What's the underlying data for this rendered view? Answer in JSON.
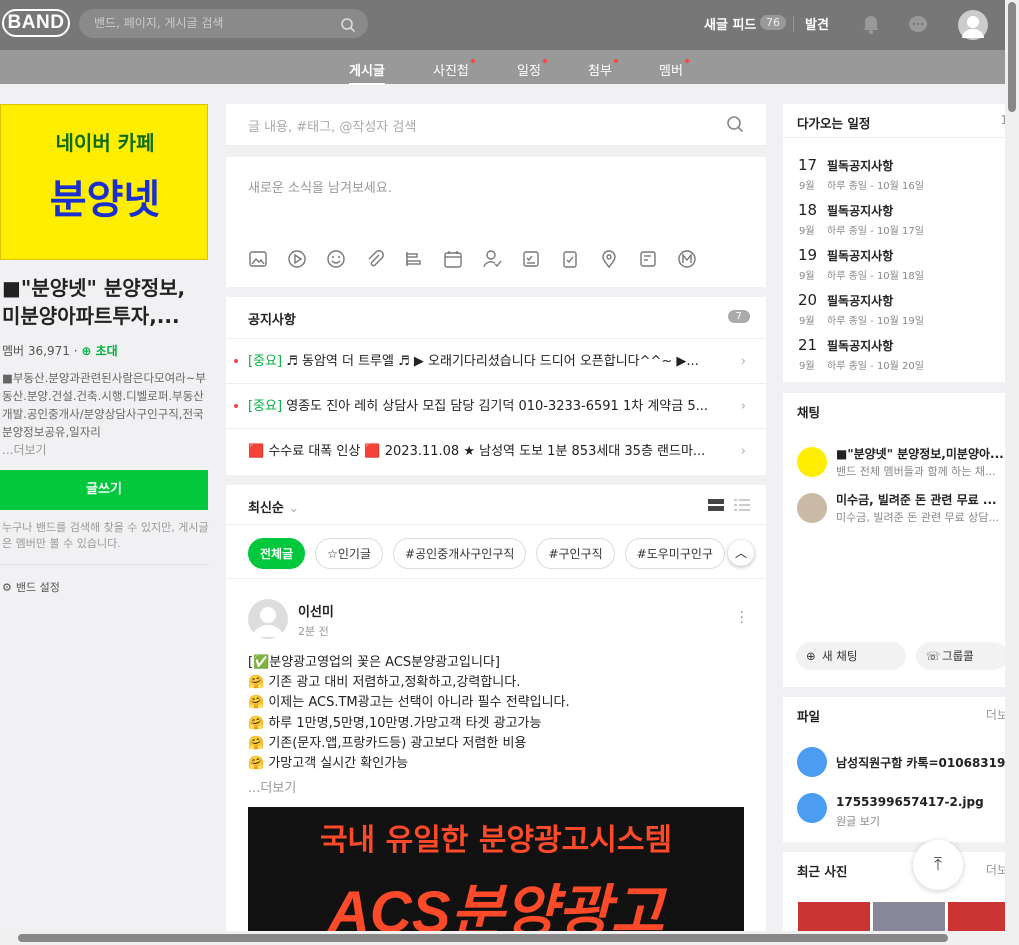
{
  "header": {
    "logo": "BAND",
    "search_placeholder": "밴드, 페이지, 게시글 검색",
    "new_feed_label": "새글 피드",
    "new_feed_count": "76",
    "discover_label": "발견"
  },
  "tabs": [
    {
      "label": "게시글",
      "active": true
    },
    {
      "label": "사진첩",
      "active": false
    },
    {
      "label": "일정",
      "active": false
    },
    {
      "label": "첨부",
      "active": false
    },
    {
      "label": "멤버",
      "active": false
    }
  ],
  "band": {
    "cover_line1": "네이버 카페",
    "cover_line2": "분양넷",
    "name": "■\"분양넷\" 분양정보, 미분양아파트투자,...",
    "members_label": "멤버 36,971 ·",
    "invite_label": "초대",
    "description": "■부동산.분양과관련된사람은다모여라~부동산.분양.건설.건축.시행.디벨로퍼.부동산개발.공인중개사/분양상담사구인구직,전국분양정보공유,일자리",
    "more_label": "...더보기",
    "write_button": "글쓰기",
    "search_note": "누구나 밴드를 검색해 찾을 수 있지만, 게시글은 멤버만 볼 수 있습니다.",
    "settings_label": "밴드 설정"
  },
  "post_search_placeholder": "글 내용, #태그, @작성자 검색",
  "compose_placeholder": "새로운 소식을 남겨보세요.",
  "notice": {
    "title": "공지사항",
    "count": "7",
    "items": [
      {
        "tag": "[중요]",
        "text": " ♬ 동암역 더 트루엘 ♬ ▶ 오래기다리셨습니다 드디어 오픈합니다^^~ ▶..."
      },
      {
        "tag": "[중요]",
        "text": " 영종도 진아 레히 상담사 모집 담당 김기덕 010-3233-6591 1차 계약금 5..."
      },
      {
        "tag": "",
        "text": "🟥 수수료 대폭 인상 🟥 2023.11.08 ★ 남성역 도보 1분 853세대 35층 랜드마..."
      }
    ]
  },
  "feed": {
    "sort_label": "최신순",
    "chips": [
      "전체글",
      "☆인기글",
      "#공인중개사구인구직",
      "#구인구직",
      "#도우미구인구"
    ],
    "post": {
      "author": "이선미",
      "time": "2분 전",
      "lines": [
        "[✅분양광고영업의 꽃은 ACS분양광고입니다]",
        "🤗 기존 광고 대비 저렴하고,정확하고,강력합니다.",
        "🤗 이제는 ACS.TM광고는 선택이 아니라 필수 전략입니다.",
        "🤗 하루 1만명,5만명,10만명.가망고객 타겟 광고가능",
        "🤗 기존(문자.앱,프랑카드등) 광고보다 저렴한 비용",
        "🤗 가망고객 실시간 확인가능"
      ],
      "more_label": "...더보기",
      "image_line1": "국내 유일한 분양광고시스템",
      "image_line2": "ACS분양광고"
    }
  },
  "schedule": {
    "title": "다가오는 일정",
    "more": "1",
    "items": [
      {
        "day": "17",
        "month": "9월",
        "title": "필독공지사항",
        "sub": "하루 종일 - 10월 16일"
      },
      {
        "day": "18",
        "month": "9월",
        "title": "필독공지사항",
        "sub": "하루 종일 - 10월 17일"
      },
      {
        "day": "19",
        "month": "9월",
        "title": "필독공지사항",
        "sub": "하루 종일 - 10월 18일"
      },
      {
        "day": "20",
        "month": "9월",
        "title": "필독공지사항",
        "sub": "하루 종일 - 10월 19일"
      },
      {
        "day": "21",
        "month": "9월",
        "title": "필독공지사항",
        "sub": "하루 종일 - 10월 20일"
      }
    ]
  },
  "chat": {
    "title": "채팅",
    "items": [
      {
        "name": "■\"분양넷\" 분양정보,미분양아...",
        "msg": "밴드 전체 멤버들과 함께 하는 채..."
      },
      {
        "name": "미수금, 빌려준 돈 관련 무료 ...",
        "msg": "미수금, 빌려준 돈 관련 무료 상담..."
      }
    ],
    "new_chat": "새 채팅",
    "group_call": "그룹콜"
  },
  "files": {
    "title": "파일",
    "more": "더보",
    "items": [
      {
        "name": "남성직원구함 카톡=01068319...",
        "sub": ""
      },
      {
        "name": "1755399657417-2.jpg",
        "sub": "원글 보기"
      }
    ]
  },
  "photos": {
    "title": "최근 사진",
    "more": "더보"
  },
  "colors": {
    "accent": "#00c73c",
    "header": "#777777",
    "cover_bg": "#ffee00"
  }
}
